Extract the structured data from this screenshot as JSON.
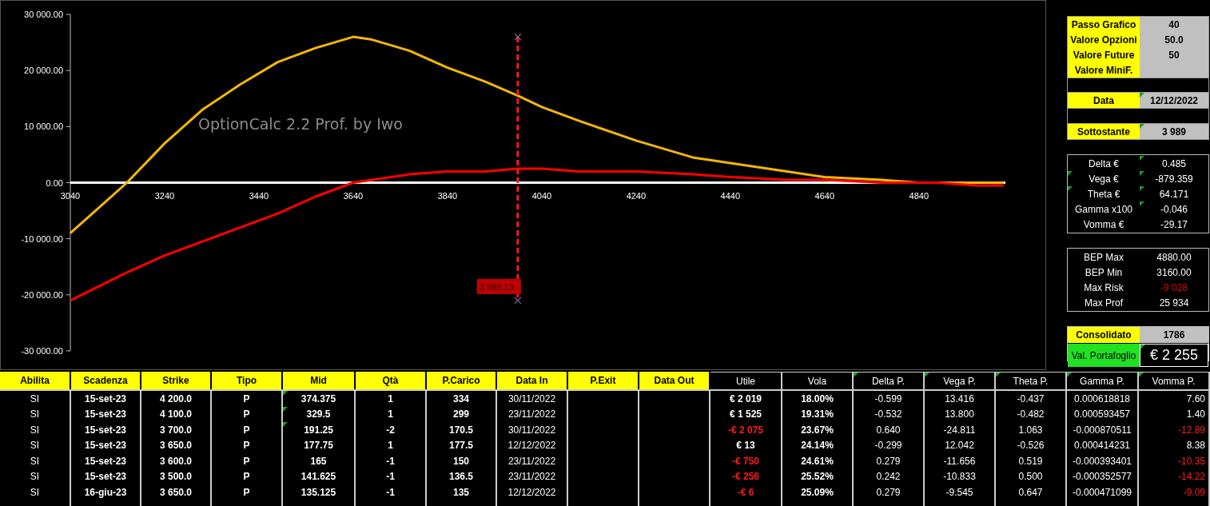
{
  "chart": {
    "chart_data": {
      "type": "line",
      "title": "OptionCalc 2.2 Prof. by Iwo",
      "x": [
        3040,
        3100,
        3160,
        3240,
        3320,
        3400,
        3480,
        3560,
        3640,
        3680,
        3760,
        3840,
        3920,
        3989,
        4040,
        4120,
        4240,
        4360,
        4440,
        4560,
        4640,
        4760,
        4840,
        4880,
        4960,
        5020
      ],
      "series": [
        {
          "color": "#f5b800",
          "values": [
            -9000,
            -4500,
            0,
            7000,
            13000,
            17500,
            21500,
            24000,
            26000,
            25500,
            23500,
            20500,
            18000,
            15500,
            13500,
            11000,
            7500,
            4500,
            3500,
            2000,
            1000,
            500,
            0,
            0,
            0,
            0
          ]
        },
        {
          "color": "#ff0000",
          "values": [
            -21000,
            -18500,
            -16000,
            -13000,
            -10500,
            -8000,
            -5500,
            -2500,
            0,
            500,
            1500,
            2000,
            2000,
            2500,
            2500,
            2000,
            2000,
            1500,
            1000,
            500,
            500,
            0,
            0,
            0,
            -500,
            -500
          ]
        }
      ],
      "xlim": [
        3040,
        5020
      ],
      "xticks": [
        3040,
        3240,
        3440,
        3640,
        3840,
        4040,
        4240,
        4440,
        4640,
        4840
      ],
      "yticks": [
        {
          "value": 30000,
          "label": "30 000.00"
        },
        {
          "value": 20000,
          "label": "20 000.00"
        },
        {
          "value": 10000,
          "label": "10 000.00"
        },
        {
          "value": 0,
          "label": "0.00"
        },
        {
          "value": -10000,
          "label": "-10 000.00"
        },
        {
          "value": -20000,
          "label": "-20 000.00"
        },
        {
          "value": -30000,
          "label": "-30 000.00"
        }
      ],
      "ylim": [
        -30000,
        30000
      ],
      "ref_lines": [
        {
          "axis": "x",
          "value": 3989.13,
          "label": "3 989.13"
        }
      ]
    }
  },
  "settings": [
    {
      "label": "Passo Grafico",
      "value": "40"
    },
    {
      "label": "Valore Opzioni",
      "value": "50.0"
    },
    {
      "label": "Valore Future",
      "value": "50"
    },
    {
      "label": "Valore MiniF."
    }
  ],
  "date": {
    "label": "Data",
    "value": "12/12/2022",
    "noted": true
  },
  "underlying": {
    "label": "Sottostante",
    "value": "3 989",
    "noted": true
  },
  "greeks": [
    {
      "label": "Delta €",
      "value": "0.485",
      "label_noted": false,
      "value_noted": true
    },
    {
      "label": "Vega €",
      "value": "-879.359",
      "label_noted": true,
      "value_noted": true
    },
    {
      "label": "Theta €",
      "value": "64.171",
      "label_noted": true,
      "value_noted": true
    },
    {
      "label": "Gamma x100",
      "value": "-0.046",
      "label_noted": false,
      "value_noted": true
    },
    {
      "label": "Vomma €",
      "value": "-29.17",
      "label_noted": false,
      "value_noted": false
    }
  ],
  "bep": [
    {
      "label": "BEP Max",
      "value": "4880.00",
      "negative": false
    },
    {
      "label": "BEP Min",
      "value": "3160.00",
      "negative": false
    },
    {
      "label": "Max Risk",
      "value": "-9 028",
      "negative": true
    },
    {
      "label": "Max Prof",
      "value": "25 934",
      "negative": false
    }
  ],
  "consolidated": {
    "label": "Consolidato",
    "value": "1786"
  },
  "portfolio": {
    "label": "Val. Portafoglio",
    "value": "€ 2 255",
    "noted": true
  },
  "table": {
    "columns": [
      {
        "label": "Abilita",
        "kind": "input",
        "noted": false
      },
      {
        "label": "Scadenza",
        "kind": "input",
        "noted": false
      },
      {
        "label": "Strike",
        "kind": "input",
        "noted": false
      },
      {
        "label": "Tipo",
        "kind": "input",
        "noted": false
      },
      {
        "label": "Mid",
        "kind": "input",
        "noted": false
      },
      {
        "label": "Qtà",
        "kind": "input",
        "noted": false
      },
      {
        "label": "P.Carico",
        "kind": "input",
        "noted": false
      },
      {
        "label": "Data In",
        "kind": "input",
        "noted": false
      },
      {
        "label": "P.Exit",
        "kind": "input",
        "noted": false
      },
      {
        "label": "Data Out",
        "kind": "input",
        "noted": false
      },
      {
        "label": "Utile",
        "kind": "output",
        "noted": false
      },
      {
        "label": "Vola",
        "kind": "output",
        "noted": false
      },
      {
        "label": "Delta P.",
        "kind": "output",
        "noted": true
      },
      {
        "label": "Vega P.",
        "kind": "output",
        "noted": true
      },
      {
        "label": "Theta P.",
        "kind": "output",
        "noted": true
      },
      {
        "label": "Gamma P.",
        "kind": "output",
        "noted": true
      },
      {
        "label": "Vomma P.",
        "kind": "output",
        "noted": true
      }
    ],
    "rows": [
      {
        "abilita": "SI",
        "scadenza": "15-set-23",
        "strike": "4 200.0",
        "tipo": "P",
        "mid": "374.375",
        "qta": "1",
        "p_carico": "334",
        "data_in": "30/11/2022",
        "utile": "€ 2 019",
        "vola": "18.00%",
        "delta_p": "-0.599",
        "vega_p": "13.416",
        "theta_p": "-0.437",
        "gamma_p": "0.000618818",
        "vomma_p": "7.60",
        "utile_negative": false,
        "vomma_negative": false,
        "mid_noted": true
      },
      {
        "abilita": "SI",
        "scadenza": "15-set-23",
        "strike": "4 100.0",
        "tipo": "P",
        "mid": "329.5",
        "qta": "1",
        "p_carico": "299",
        "data_in": "23/11/2022",
        "utile": "€ 1 525",
        "vola": "19.31%",
        "delta_p": "-0.532",
        "vega_p": "13.800",
        "theta_p": "-0.482",
        "gamma_p": "0.000593457",
        "vomma_p": "1.40",
        "utile_negative": false,
        "vomma_negative": false,
        "mid_noted": true
      },
      {
        "abilita": "SI",
        "scadenza": "15-set-23",
        "strike": "3 700.0",
        "tipo": "P",
        "mid": "191.25",
        "qta": "-2",
        "p_carico": "170.5",
        "data_in": "30/11/2022",
        "utile": "-€ 2 075",
        "vola": "23.67%",
        "delta_p": "0.640",
        "vega_p": "-24.811",
        "theta_p": "1.063",
        "gamma_p": "-0.000870511",
        "vomma_p": "-12.89",
        "utile_negative": true,
        "vomma_negative": true,
        "mid_noted": true
      },
      {
        "abilita": "SI",
        "scadenza": "15-set-23",
        "strike": "3 650.0",
        "tipo": "P",
        "mid": "177.75",
        "qta": "1",
        "p_carico": "177.5",
        "data_in": "12/12/2022",
        "utile": "€ 13",
        "vola": "24.14%",
        "delta_p": "-0.299",
        "vega_p": "12.042",
        "theta_p": "-0.526",
        "gamma_p": "0.000414231",
        "vomma_p": "8.38",
        "utile_negative": false,
        "vomma_negative": false,
        "mid_noted": false
      },
      {
        "abilita": "SI",
        "scadenza": "15-set-23",
        "strike": "3 600.0",
        "tipo": "P",
        "mid": "165",
        "qta": "-1",
        "p_carico": "150",
        "data_in": "23/11/2022",
        "utile": "-€ 750",
        "vola": "24.61%",
        "delta_p": "0.279",
        "vega_p": "-11.656",
        "theta_p": "0.519",
        "gamma_p": "-0.000393401",
        "vomma_p": "-10.35",
        "utile_negative": true,
        "vomma_negative": true,
        "mid_noted": false
      },
      {
        "abilita": "SI",
        "scadenza": "15-set-23",
        "strike": "3 500.0",
        "tipo": "P",
        "mid": "141.625",
        "qta": "-1",
        "p_carico": "136.5",
        "data_in": "23/11/2022",
        "utile": "-€ 256",
        "vola": "25.52%",
        "delta_p": "0.242",
        "vega_p": "-10.833",
        "theta_p": "0.500",
        "gamma_p": "-0.000352577",
        "vomma_p": "-14.22",
        "utile_negative": true,
        "vomma_negative": true,
        "mid_noted": false
      },
      {
        "abilita": "SI",
        "scadenza": "16-giu-23",
        "strike": "3 650.0",
        "tipo": "P",
        "mid": "135.125",
        "qta": "-1",
        "p_carico": "135",
        "data_in": "12/12/2022",
        "utile": "-€ 6",
        "vola": "25.09%",
        "delta_p": "0.279",
        "vega_p": "-9.545",
        "theta_p": "0.647",
        "gamma_p": "-0.000471099",
        "vomma_p": "-9.09",
        "utile_negative": true,
        "vomma_negative": true,
        "mid_noted": false
      }
    ]
  }
}
